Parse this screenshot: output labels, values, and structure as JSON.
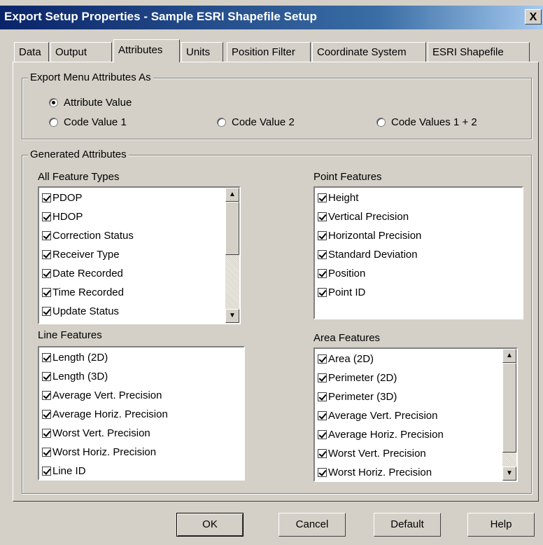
{
  "window": {
    "title": "Export Setup Properties - Sample ESRI Shapefile Setup",
    "close_label": "X"
  },
  "tabs": [
    {
      "label": "Data"
    },
    {
      "label": "Output"
    },
    {
      "label": "Attributes"
    },
    {
      "label": "Units"
    },
    {
      "label": "Position Filter"
    },
    {
      "label": "Coordinate System"
    },
    {
      "label": "ESRI Shapefile"
    }
  ],
  "active_tab": "Attributes",
  "export_group": {
    "label": "Export Menu Attributes As",
    "options": [
      {
        "label": "Attribute Value",
        "selected": true
      },
      {
        "label": "Code Value 1",
        "selected": false
      },
      {
        "label": "Code Value 2",
        "selected": false
      },
      {
        "label": "Code Values 1 + 2",
        "selected": false
      }
    ]
  },
  "generated_group": {
    "label": "Generated Attributes"
  },
  "all_feature_types": {
    "label": "All Feature Types",
    "items": [
      {
        "label": "PDOP",
        "checked": true
      },
      {
        "label": "HDOP",
        "checked": true
      },
      {
        "label": "Correction Status",
        "checked": true
      },
      {
        "label": "Receiver Type",
        "checked": true
      },
      {
        "label": "Date Recorded",
        "checked": true
      },
      {
        "label": "Time Recorded",
        "checked": true
      },
      {
        "label": "Update Status",
        "checked": true
      }
    ]
  },
  "point_features": {
    "label": "Point Features",
    "items": [
      {
        "label": "Height",
        "checked": true
      },
      {
        "label": "Vertical Precision",
        "checked": true
      },
      {
        "label": "Horizontal Precision",
        "checked": true
      },
      {
        "label": "Standard Deviation",
        "checked": true
      },
      {
        "label": "Position",
        "checked": true
      },
      {
        "label": "Point ID",
        "checked": true
      }
    ]
  },
  "line_features": {
    "label": "Line Features",
    "items": [
      {
        "label": "Length (2D)",
        "checked": true
      },
      {
        "label": "Length (3D)",
        "checked": true
      },
      {
        "label": "Average Vert. Precision",
        "checked": true
      },
      {
        "label": "Average Horiz. Precision",
        "checked": true
      },
      {
        "label": "Worst Vert. Precision",
        "checked": true
      },
      {
        "label": "Worst Horiz. Precision",
        "checked": true
      },
      {
        "label": "Line ID",
        "checked": true
      }
    ]
  },
  "area_features": {
    "label": "Area Features",
    "items": [
      {
        "label": "Area (2D)",
        "checked": true
      },
      {
        "label": "Perimeter (2D)",
        "checked": true
      },
      {
        "label": "Perimeter (3D)",
        "checked": true
      },
      {
        "label": "Average Vert. Precision",
        "checked": true
      },
      {
        "label": "Average Horiz. Precision",
        "checked": true
      },
      {
        "label": "Worst Vert. Precision",
        "checked": true
      },
      {
        "label": "Worst Horiz. Precision",
        "checked": true
      }
    ]
  },
  "buttons": {
    "ok": "OK",
    "cancel": "Cancel",
    "default": "Default",
    "help": "Help"
  },
  "icons": {
    "scroll_up": "scroll-up-arrow-icon",
    "scroll_down": "scroll-down-arrow-icon"
  }
}
